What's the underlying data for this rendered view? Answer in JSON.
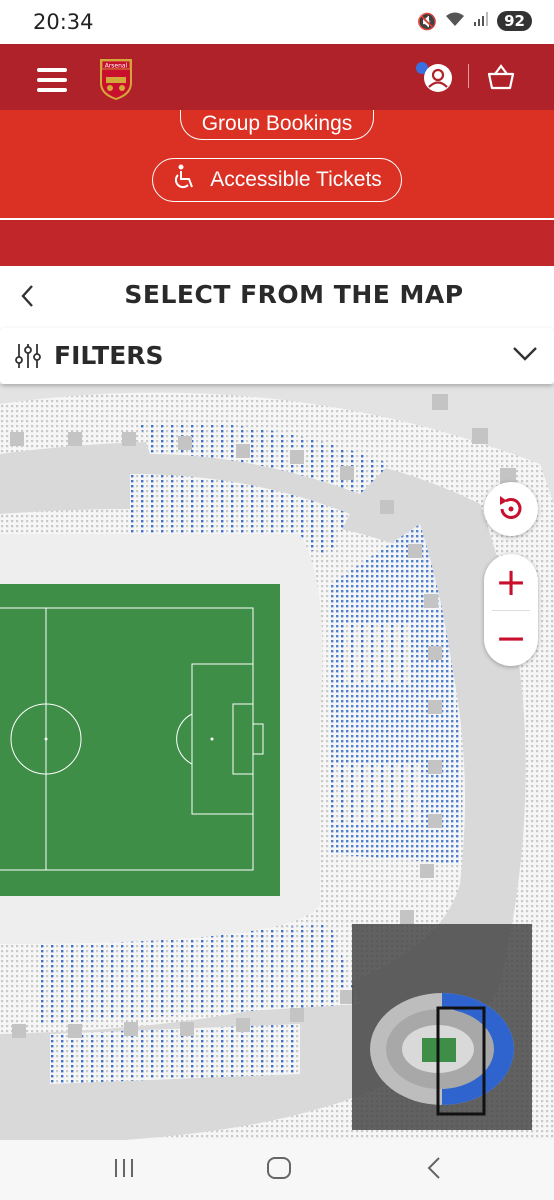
{
  "status_bar": {
    "time": "20:34",
    "battery": "92"
  },
  "header": {
    "logo_text": "Arsenal"
  },
  "promo": {
    "group_bookings_label": "Group Bookings",
    "accessible_tickets_label": "Accessible Tickets"
  },
  "page": {
    "title": "SELECT FROM THE MAP"
  },
  "filters": {
    "label": "FILTERS"
  },
  "map": {
    "zoom_in_label": "+",
    "zoom_out_label": "−"
  },
  "colors": {
    "brand_red": "#b0222a",
    "promo_red": "#db3024",
    "available_seat": "#3d72cc",
    "pitch_green": "#3e8e47"
  }
}
